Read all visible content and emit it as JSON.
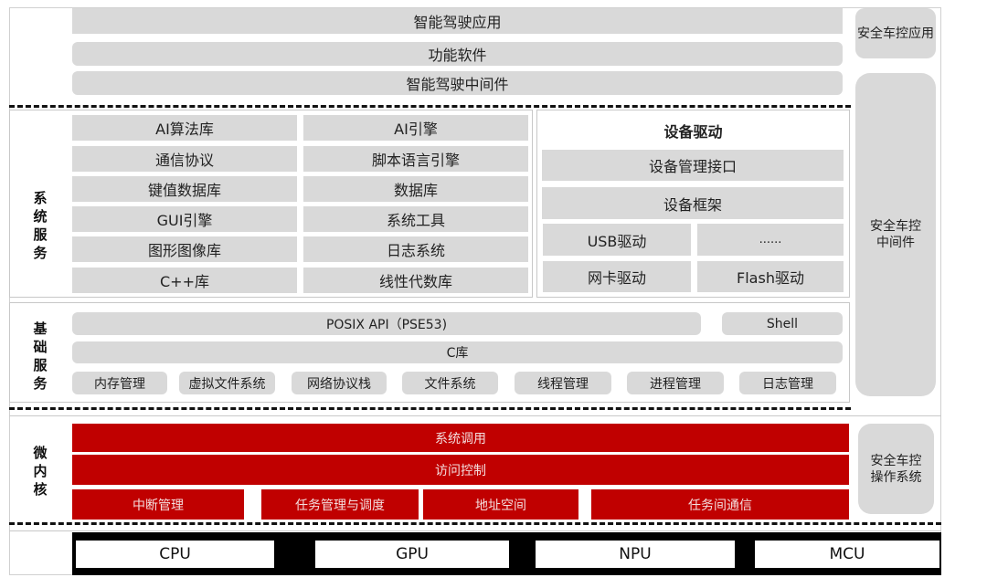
{
  "app_layer": {
    "rows": [
      "智能驾驶应用",
      "功能软件",
      "智能驾驶中间件"
    ]
  },
  "safety_column": {
    "app": "安全车控应用",
    "middleware": [
      "安全车控",
      "中间件"
    ],
    "os": [
      "安全车控",
      "操作系统"
    ]
  },
  "system_services": {
    "label": [
      "系",
      "统",
      "服",
      "务"
    ],
    "left": [
      "AI算法库",
      "通信协议",
      "键值数据库",
      "GUI引擎",
      "图形图像库",
      "C++库"
    ],
    "right": [
      "AI引擎",
      "脚本语言引擎",
      "数据库",
      "系统工具",
      "日志系统",
      "线性代数库"
    ],
    "device_driver": {
      "title": "设备驱动",
      "mgmt_interface": "设备管理接口",
      "framework": "设备框架",
      "drivers": [
        "USB驱动",
        "......",
        "网卡驱动",
        "Flash驱动"
      ]
    }
  },
  "basic_services": {
    "label": [
      "基",
      "础",
      "服",
      "务"
    ],
    "posix": "POSIX API（PSE53)",
    "shell": "Shell",
    "clib": "C库",
    "modules": [
      "内存管理",
      "虚拟文件系统",
      "网络协议栈",
      "文件系统",
      "线程管理",
      "进程管理",
      "日志管理"
    ]
  },
  "microkernel": {
    "label": [
      "微",
      "内",
      "核"
    ],
    "syscall": "系统调用",
    "access_control": "访问控制",
    "modules": [
      "中断管理",
      "任务管理与调度",
      "地址空间",
      "任务间通信"
    ],
    "color": "#c00000"
  },
  "hardware": {
    "units": [
      "CPU",
      "GPU",
      "NPU",
      "MCU"
    ]
  }
}
